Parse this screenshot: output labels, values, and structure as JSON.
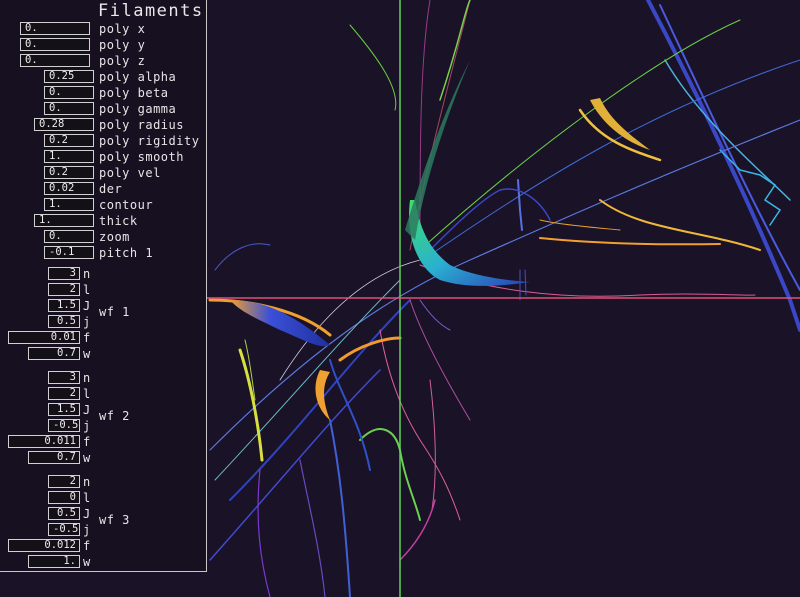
{
  "panel": {
    "title": "Filaments",
    "top_params": [
      {
        "label": "poly x",
        "value": "0."
      },
      {
        "label": "poly y",
        "value": "0."
      },
      {
        "label": "poly z",
        "value": "0."
      },
      {
        "label": "poly alpha",
        "value": "0.25"
      },
      {
        "label": "poly beta",
        "value": "0."
      },
      {
        "label": "poly gamma",
        "value": "0."
      },
      {
        "label": "poly radius",
        "value": "0.28"
      },
      {
        "label": "poly rigidity",
        "value": "0.2"
      },
      {
        "label": "poly smooth",
        "value": "1."
      },
      {
        "label": "poly vel",
        "value": "0.2"
      },
      {
        "label": "der",
        "value": "0.02"
      },
      {
        "label": "contour",
        "value": "1."
      },
      {
        "label": "thick",
        "value": "1."
      },
      {
        "label": "zoom",
        "value": "0."
      },
      {
        "label": "pitch 1",
        "value": "-0.1"
      }
    ],
    "groups": [
      {
        "label": "wf 1",
        "params": [
          {
            "label": "n",
            "value": "3"
          },
          {
            "label": "l",
            "value": "2"
          },
          {
            "label": "J",
            "value": "1.5"
          },
          {
            "label": "j",
            "value": "0.5"
          },
          {
            "label": "f",
            "value": "0.01"
          },
          {
            "label": "w",
            "value": "0.7"
          }
        ]
      },
      {
        "label": "wf 2",
        "params": [
          {
            "label": "n",
            "value": "3"
          },
          {
            "label": "l",
            "value": "2"
          },
          {
            "label": "J",
            "value": "1.5"
          },
          {
            "label": "j",
            "value": "-0.5"
          },
          {
            "label": "f",
            "value": "0.011"
          },
          {
            "label": "w",
            "value": "0.7"
          }
        ]
      },
      {
        "label": "wf 3",
        "params": [
          {
            "label": "n",
            "value": "2"
          },
          {
            "label": "l",
            "value": "0"
          },
          {
            "label": "J",
            "value": "0.5"
          },
          {
            "label": "j",
            "value": "-0.5"
          },
          {
            "label": "f",
            "value": "0.012"
          },
          {
            "label": "w",
            "value": "1."
          }
        ]
      }
    ]
  },
  "viewport": {
    "background": "#1a1226",
    "vertical_axis_color": "#5fd35a",
    "horizontal_axis_color": "#e0507a"
  }
}
